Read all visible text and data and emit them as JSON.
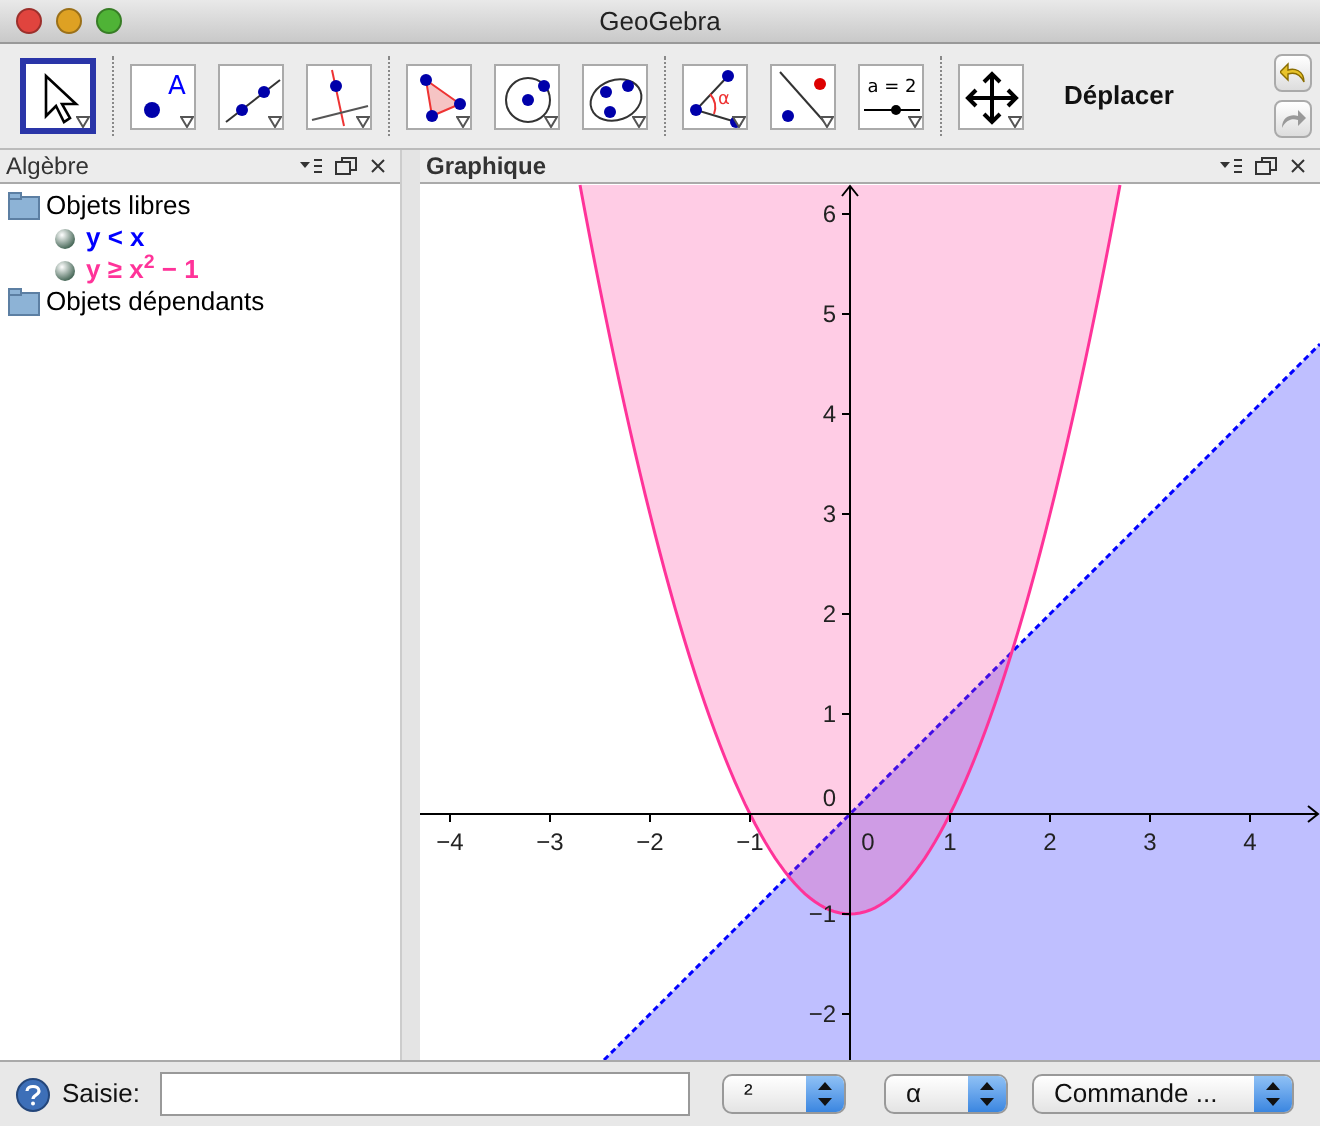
{
  "window": {
    "title": "GeoGebra"
  },
  "toolbar": {
    "tools": [
      {
        "kind": "pointer",
        "selected": true
      },
      {
        "kind": "point",
        "selected": false,
        "label": "A"
      },
      {
        "kind": "line",
        "selected": false
      },
      {
        "kind": "perpendicular",
        "selected": false
      },
      {
        "kind": "polygon",
        "selected": false
      },
      {
        "kind": "circle",
        "selected": false
      },
      {
        "kind": "conic",
        "selected": false
      },
      {
        "kind": "angle",
        "selected": false,
        "label": "α"
      },
      {
        "kind": "reflect",
        "selected": false
      },
      {
        "kind": "slider",
        "selected": false,
        "label": "a = 2"
      },
      {
        "kind": "move",
        "selected": false
      }
    ],
    "tool_name": "Déplacer"
  },
  "algebra": {
    "title": "Algèbre",
    "folders": [
      {
        "label": "Objets libres",
        "children": [
          {
            "label": "y < x",
            "color": "#0000ff"
          },
          {
            "label": "y ≥ x$^{2}$ − 1",
            "color": "#ff3399"
          }
        ]
      },
      {
        "label": "Objets dépendants"
      }
    ]
  },
  "graphics": {
    "title": "Graphique",
    "x_labels": [
      "−4",
      "−3",
      "−2",
      "−1",
      "0",
      "1",
      "2",
      "3",
      "4"
    ],
    "y_labels": [
      "6",
      "5",
      "4",
      "3",
      "2",
      "1",
      "0",
      "−1",
      "−2"
    ],
    "objects": [
      {
        "kind": "below_line",
        "color": "#0000ff"
      },
      {
        "kind": "above_parabola",
        "color": "#ff3399"
      }
    ]
  },
  "input_bar": {
    "label": "Saisie:",
    "menus": [
      "²",
      "α",
      "Commande ..."
    ]
  }
}
